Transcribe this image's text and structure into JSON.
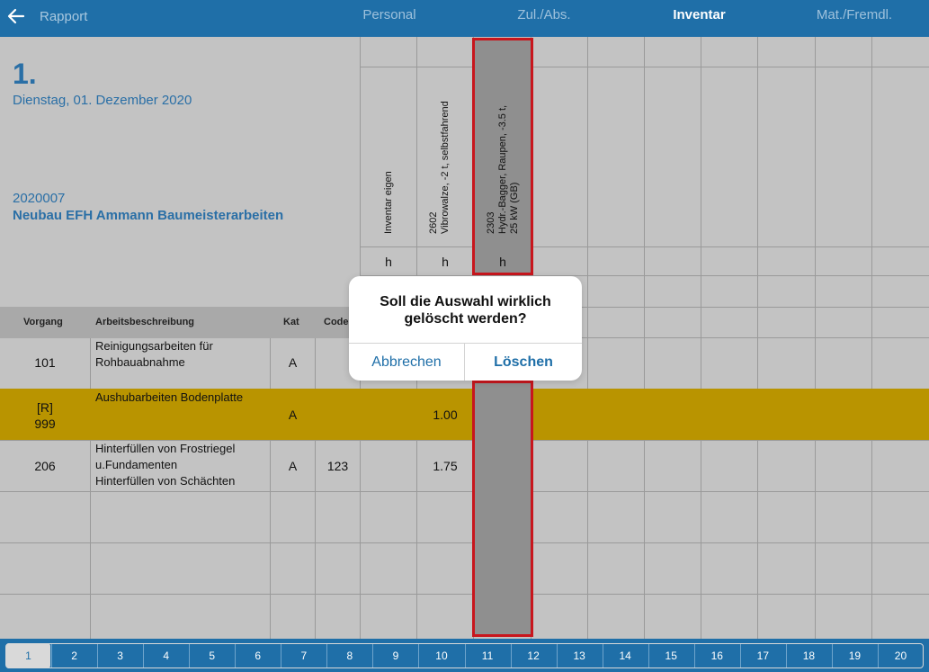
{
  "nav": {
    "back_label": "Rapport",
    "tabs": [
      "Personal",
      "Zul./Abs.",
      "Inventar",
      "Mat./Fremdl."
    ],
    "active_tab": "Inventar"
  },
  "header": {
    "day_number": "1.",
    "date": "Dienstag, 01. Dezember 2020",
    "project_number": "2020007",
    "project_name": "Neubau EFH Ammann Baumeisterarbeiten"
  },
  "columns": [
    {
      "lines": [
        "Inventar eigen"
      ],
      "unit": "h"
    },
    {
      "lines": [
        "2602",
        "Vibrowalze, -2 t, selbstfahrend"
      ],
      "unit": "h"
    },
    {
      "lines": [
        "2303",
        "Hydr.-Bagger, Raupen, -3.5 t,",
        "25 kW (GB)"
      ],
      "unit": "h"
    }
  ],
  "table": {
    "headers": {
      "vorgang": "Vorgang",
      "beschreibung": "Arbeitsbeschreibung",
      "kat": "Kat",
      "code": "Code"
    },
    "rows": [
      {
        "vorgang": "101",
        "beschreibung": [
          "Reinigungsarbeiten für",
          "Rohbauabnahme"
        ],
        "kat": "A",
        "code": "",
        "value": ""
      },
      {
        "vorgang": "[R]\n999",
        "vorgang_top": "[R]",
        "vorgang_bottom": "999",
        "beschreibung": [
          "Aushubarbeiten Bodenplatte"
        ],
        "kat": "A",
        "code": "",
        "value": "1.00"
      },
      {
        "vorgang": "206",
        "beschreibung": [
          "Hinterfüllen von Frostriegel",
          "u.Fundamenten",
          "Hinterfüllen von Schächten"
        ],
        "kat": "A",
        "code": "123",
        "value": "1.75"
      }
    ]
  },
  "dialog": {
    "message_line1": "Soll die Auswahl wirklich",
    "message_line2": "gelöscht werden?",
    "cancel_label": "Abbrechen",
    "delete_label": "Löschen"
  },
  "pager": {
    "pages": [
      "1",
      "2",
      "3",
      "4",
      "5",
      "6",
      "7",
      "8",
      "9",
      "10",
      "11",
      "12",
      "13",
      "14",
      "15",
      "16",
      "17",
      "18",
      "19",
      "20"
    ],
    "active_page": "1"
  },
  "colors": {
    "nav_bg": "#1f6fa8",
    "highlight_row": "#b99400",
    "selection_border": "#c8161d",
    "accent_text": "#2a6fa6"
  }
}
